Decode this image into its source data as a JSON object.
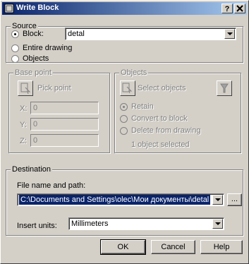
{
  "window": {
    "title": "Write Block",
    "help_label": "?",
    "close_label": "X"
  },
  "source": {
    "group_label": "Source",
    "block_label": "Block:",
    "block_value": "detal",
    "entire_label": "Entire drawing",
    "objects_label": "Objects"
  },
  "basepoint": {
    "group_label": "Base point",
    "pick_label": "Pick point",
    "x_label": "X:",
    "x_value": "0",
    "y_label": "Y:",
    "y_value": "0",
    "z_label": "Z:",
    "z_value": "0"
  },
  "objects": {
    "group_label": "Objects",
    "select_label": "Select objects",
    "retain_label": "Retain",
    "convert_label": "Convert to block",
    "delete_label": "Delete from drawing",
    "status": "1 object selected"
  },
  "destination": {
    "group_label": "Destination",
    "filepath_label": "File name and path:",
    "filepath_value": "C:\\Documents and Settings\\olec\\Мои документы\\detal",
    "browse_label": "...",
    "units_label": "Insert units:",
    "units_value": "Millimeters"
  },
  "buttons": {
    "ok": "OK",
    "cancel": "Cancel",
    "help": "Help"
  },
  "colors": {
    "title_start": "#0a246a",
    "title_end": "#a6caf0",
    "selection": "#0a246a",
    "face": "#d4d0c8"
  }
}
